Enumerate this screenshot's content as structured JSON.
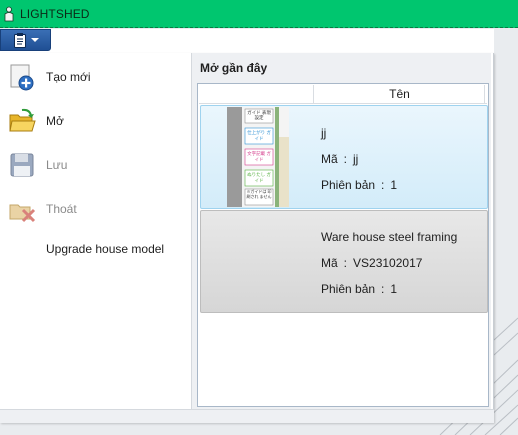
{
  "titlebar": {
    "title": "LIGHTSHED",
    "icon": "person-icon"
  },
  "toolbar": {
    "menu_icon": "clipboard-icon",
    "dropdown_icon": "chevron-down-icon"
  },
  "menu": {
    "items": [
      {
        "label": "Tạo mới",
        "icon": "new-document-icon",
        "enabled": true
      },
      {
        "label": "Mở",
        "icon": "open-folder-icon",
        "enabled": true
      },
      {
        "label": "Lưu",
        "icon": "save-disk-icon",
        "enabled": false
      },
      {
        "label": "Thoát",
        "icon": "exit-icon",
        "enabled": false
      },
      {
        "label": "Upgrade house model",
        "icon": "",
        "enabled": true
      }
    ]
  },
  "recent": {
    "title": "Mở gần đây",
    "column_name": "Tên",
    "code_label": "Mã",
    "version_label": "Phiên bản",
    "separator": ":",
    "items": [
      {
        "name": "jj",
        "code": "jj",
        "version": "1",
        "thumbnail": "document-thumbnail",
        "thumb_labels": [
          "ガイド 表現設定",
          "仕上がり ガイド",
          "文字記載 ガイド",
          "ぬりたし ガイド",
          "※ガイドは 印刷され ません"
        ]
      },
      {
        "name": "Ware house steel framing",
        "code": "VS23102017",
        "version": "1",
        "thumbnail": ""
      }
    ]
  },
  "colors": {
    "titlebar": "#00c66f",
    "accent": "#1f4f94",
    "selection": "#d3ecf9"
  }
}
